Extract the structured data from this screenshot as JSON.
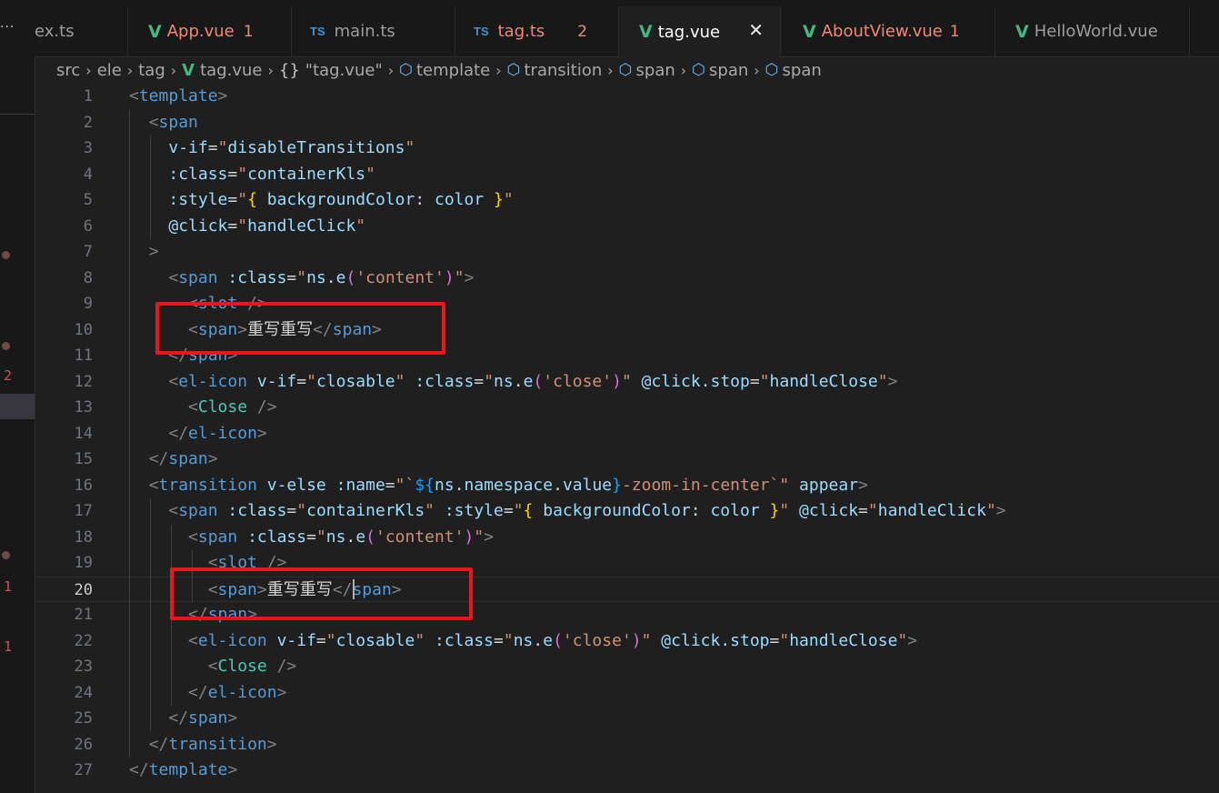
{
  "tabs": [
    {
      "label": "ex.ts",
      "kind": "none",
      "badge": "",
      "error": false,
      "active": false
    },
    {
      "label": "App.vue",
      "kind": "vue",
      "badge": "1",
      "error": true,
      "active": false
    },
    {
      "label": "main.ts",
      "kind": "ts",
      "badge": "",
      "error": false,
      "active": false
    },
    {
      "label": "tag.ts",
      "kind": "ts",
      "badge": "2",
      "error": true,
      "active": false
    },
    {
      "label": "tag.vue",
      "kind": "vue",
      "badge": "",
      "error": false,
      "active": true
    },
    {
      "label": "AboutView.vue",
      "kind": "vue",
      "badge": "1",
      "error": true,
      "active": false
    },
    {
      "label": "HelloWorld.vue",
      "kind": "vue",
      "badge": "",
      "error": false,
      "active": false
    }
  ],
  "icons": {
    "vue": "V",
    "ts": "TS",
    "close": "✕",
    "more": "···",
    "cube": "⬡",
    "braces": "{}",
    "chevron": "›"
  },
  "breadcrumb": [
    "src",
    "ele",
    "tag",
    "tag.vue",
    "\"tag.vue\"",
    "template",
    "transition",
    "span",
    "span",
    "span"
  ],
  "gutter_markers": [
    "2",
    "1",
    "1"
  ],
  "current_line": 20,
  "lines": [
    {
      "n": "1",
      "tokens": [
        [
          "p",
          "<"
        ],
        [
          "tg",
          "template"
        ],
        [
          "p",
          ">"
        ]
      ]
    },
    {
      "n": "2",
      "tokens": [
        [
          "wh",
          "  "
        ],
        [
          "p",
          "<"
        ],
        [
          "tg",
          "span"
        ]
      ]
    },
    {
      "n": "3",
      "tokens": [
        [
          "wh",
          "    "
        ],
        [
          "at",
          "v-if"
        ],
        [
          "wh",
          "="
        ],
        [
          "st",
          "\""
        ],
        [
          "at",
          "disableTransitions"
        ],
        [
          "st",
          "\""
        ]
      ]
    },
    {
      "n": "4",
      "tokens": [
        [
          "wh",
          "    "
        ],
        [
          "at",
          ":class"
        ],
        [
          "wh",
          "="
        ],
        [
          "st",
          "\""
        ],
        [
          "at",
          "containerKls"
        ],
        [
          "st",
          "\""
        ]
      ]
    },
    {
      "n": "5",
      "tokens": [
        [
          "wh",
          "    "
        ],
        [
          "at",
          ":style"
        ],
        [
          "wh",
          "="
        ],
        [
          "st",
          "\""
        ],
        [
          "bk",
          "{"
        ],
        [
          "at",
          " backgroundColor"
        ],
        [
          "wh",
          ": "
        ],
        [
          "at",
          "color"
        ],
        [
          "bk",
          " }"
        ],
        [
          "st",
          "\""
        ]
      ]
    },
    {
      "n": "6",
      "tokens": [
        [
          "wh",
          "    "
        ],
        [
          "at",
          "@click"
        ],
        [
          "wh",
          "="
        ],
        [
          "st",
          "\""
        ],
        [
          "at",
          "handleClick"
        ],
        [
          "st",
          "\""
        ]
      ]
    },
    {
      "n": "7",
      "tokens": [
        [
          "wh",
          "  "
        ],
        [
          "p",
          ">"
        ]
      ]
    },
    {
      "n": "8",
      "tokens": [
        [
          "wh",
          "    "
        ],
        [
          "p",
          "<"
        ],
        [
          "tg",
          "span"
        ],
        [
          "at",
          " :class"
        ],
        [
          "wh",
          "="
        ],
        [
          "st",
          "\""
        ],
        [
          "at",
          "ns"
        ],
        [
          "wh",
          "."
        ],
        [
          "at",
          "e"
        ],
        [
          "pk",
          "("
        ],
        [
          "st",
          "'content'"
        ],
        [
          "pk",
          ")"
        ],
        [
          "st",
          "\""
        ],
        [
          "p",
          ">"
        ]
      ]
    },
    {
      "n": "9",
      "tokens": [
        [
          "wh",
          "      "
        ],
        [
          "p",
          "<"
        ],
        [
          "tg",
          "slot"
        ],
        [
          "p",
          " />"
        ]
      ]
    },
    {
      "n": "10",
      "tokens": [
        [
          "wh",
          "      "
        ],
        [
          "p",
          "<"
        ],
        [
          "tg",
          "span"
        ],
        [
          "p",
          ">"
        ],
        [
          "tx",
          "重写重写"
        ],
        [
          "p",
          "</"
        ],
        [
          "tg",
          "span"
        ],
        [
          "p",
          ">"
        ]
      ]
    },
    {
      "n": "11",
      "tokens": [
        [
          "wh",
          "    "
        ],
        [
          "p",
          "</"
        ],
        [
          "tg",
          "span"
        ],
        [
          "p",
          ">"
        ]
      ]
    },
    {
      "n": "12",
      "tokens": [
        [
          "wh",
          "    "
        ],
        [
          "p",
          "<"
        ],
        [
          "tg",
          "el-icon"
        ],
        [
          "at",
          " v-if"
        ],
        [
          "wh",
          "="
        ],
        [
          "st",
          "\""
        ],
        [
          "at",
          "closable"
        ],
        [
          "st",
          "\""
        ],
        [
          "at",
          " :class"
        ],
        [
          "wh",
          "="
        ],
        [
          "st",
          "\""
        ],
        [
          "at",
          "ns"
        ],
        [
          "wh",
          "."
        ],
        [
          "at",
          "e"
        ],
        [
          "pk",
          "("
        ],
        [
          "st",
          "'close'"
        ],
        [
          "pk",
          ")"
        ],
        [
          "st",
          "\""
        ],
        [
          "at",
          " @click.stop"
        ],
        [
          "wh",
          "="
        ],
        [
          "st",
          "\""
        ],
        [
          "at",
          "handleClose"
        ],
        [
          "st",
          "\""
        ],
        [
          "p",
          ">"
        ]
      ]
    },
    {
      "n": "13",
      "tokens": [
        [
          "wh",
          "      "
        ],
        [
          "p",
          "<"
        ],
        [
          "cm",
          "Close"
        ],
        [
          "p",
          " />"
        ]
      ]
    },
    {
      "n": "14",
      "tokens": [
        [
          "wh",
          "    "
        ],
        [
          "p",
          "</"
        ],
        [
          "tg",
          "el-icon"
        ],
        [
          "p",
          ">"
        ]
      ]
    },
    {
      "n": "15",
      "tokens": [
        [
          "wh",
          "  "
        ],
        [
          "p",
          "</"
        ],
        [
          "tg",
          "span"
        ],
        [
          "p",
          ">"
        ]
      ]
    },
    {
      "n": "16",
      "tokens": [
        [
          "wh",
          "  "
        ],
        [
          "p",
          "<"
        ],
        [
          "tg",
          "transition"
        ],
        [
          "at",
          " v-else"
        ],
        [
          "at",
          " :name"
        ],
        [
          "wh",
          "="
        ],
        [
          "st",
          "\""
        ],
        [
          "st",
          "`"
        ],
        [
          "bl",
          "${"
        ],
        [
          "at",
          "ns"
        ],
        [
          "wh",
          "."
        ],
        [
          "at",
          "namespace"
        ],
        [
          "wh",
          "."
        ],
        [
          "at",
          "value"
        ],
        [
          "bl",
          "}"
        ],
        [
          "st",
          "-zoom-in-center`"
        ],
        [
          "st",
          "\""
        ],
        [
          "at",
          " appear"
        ],
        [
          "p",
          ">"
        ]
      ]
    },
    {
      "n": "17",
      "tokens": [
        [
          "wh",
          "    "
        ],
        [
          "p",
          "<"
        ],
        [
          "tg",
          "span"
        ],
        [
          "at",
          " :class"
        ],
        [
          "wh",
          "="
        ],
        [
          "st",
          "\""
        ],
        [
          "at",
          "containerKls"
        ],
        [
          "st",
          "\""
        ],
        [
          "at",
          " :style"
        ],
        [
          "wh",
          "="
        ],
        [
          "st",
          "\""
        ],
        [
          "bk",
          "{"
        ],
        [
          "at",
          " backgroundColor"
        ],
        [
          "wh",
          ": "
        ],
        [
          "at",
          "color"
        ],
        [
          "bk",
          " }"
        ],
        [
          "st",
          "\""
        ],
        [
          "at",
          " @click"
        ],
        [
          "wh",
          "="
        ],
        [
          "st",
          "\""
        ],
        [
          "at",
          "handleClick"
        ],
        [
          "st",
          "\""
        ],
        [
          "p",
          ">"
        ]
      ]
    },
    {
      "n": "18",
      "tokens": [
        [
          "wh",
          "      "
        ],
        [
          "p",
          "<"
        ],
        [
          "tg",
          "span"
        ],
        [
          "at",
          " :class"
        ],
        [
          "wh",
          "="
        ],
        [
          "st",
          "\""
        ],
        [
          "at",
          "ns"
        ],
        [
          "wh",
          "."
        ],
        [
          "at",
          "e"
        ],
        [
          "pk",
          "("
        ],
        [
          "st",
          "'content'"
        ],
        [
          "pk",
          ")"
        ],
        [
          "st",
          "\""
        ],
        [
          "p",
          ">"
        ]
      ]
    },
    {
      "n": "19",
      "tokens": [
        [
          "wh",
          "        "
        ],
        [
          "p",
          "<"
        ],
        [
          "tg",
          "slot"
        ],
        [
          "p",
          " />"
        ]
      ]
    },
    {
      "n": "20",
      "tokens": [
        [
          "wh",
          "        "
        ],
        [
          "p",
          "<"
        ],
        [
          "tg",
          "span"
        ],
        [
          "p",
          ">"
        ],
        [
          "tx",
          "重写重写"
        ],
        [
          "p",
          "</"
        ],
        [
          "tg",
          "span"
        ],
        [
          "p",
          ">"
        ]
      ]
    },
    {
      "n": "21",
      "tokens": [
        [
          "wh",
          "      "
        ],
        [
          "p",
          "</"
        ],
        [
          "tg",
          "span"
        ],
        [
          "p",
          ">"
        ]
      ]
    },
    {
      "n": "22",
      "tokens": [
        [
          "wh",
          "      "
        ],
        [
          "p",
          "<"
        ],
        [
          "tg",
          "el-icon"
        ],
        [
          "at",
          " v-if"
        ],
        [
          "wh",
          "="
        ],
        [
          "st",
          "\""
        ],
        [
          "at",
          "closable"
        ],
        [
          "st",
          "\""
        ],
        [
          "at",
          " :class"
        ],
        [
          "wh",
          "="
        ],
        [
          "st",
          "\""
        ],
        [
          "at",
          "ns"
        ],
        [
          "wh",
          "."
        ],
        [
          "at",
          "e"
        ],
        [
          "pk",
          "("
        ],
        [
          "st",
          "'close'"
        ],
        [
          "pk",
          ")"
        ],
        [
          "st",
          "\""
        ],
        [
          "at",
          " @click.stop"
        ],
        [
          "wh",
          "="
        ],
        [
          "st",
          "\""
        ],
        [
          "at",
          "handleClose"
        ],
        [
          "st",
          "\""
        ],
        [
          "p",
          ">"
        ]
      ]
    },
    {
      "n": "23",
      "tokens": [
        [
          "wh",
          "        "
        ],
        [
          "p",
          "<"
        ],
        [
          "cm",
          "Close"
        ],
        [
          "p",
          " />"
        ]
      ]
    },
    {
      "n": "24",
      "tokens": [
        [
          "wh",
          "      "
        ],
        [
          "p",
          "</"
        ],
        [
          "tg",
          "el-icon"
        ],
        [
          "p",
          ">"
        ]
      ]
    },
    {
      "n": "25",
      "tokens": [
        [
          "wh",
          "    "
        ],
        [
          "p",
          "</"
        ],
        [
          "tg",
          "span"
        ],
        [
          "p",
          ">"
        ]
      ]
    },
    {
      "n": "26",
      "tokens": [
        [
          "wh",
          "  "
        ],
        [
          "p",
          "</"
        ],
        [
          "tg",
          "transition"
        ],
        [
          "p",
          ">"
        ]
      ]
    },
    {
      "n": "27",
      "tokens": [
        [
          "p",
          "</"
        ],
        [
          "tg",
          "template"
        ],
        [
          "p",
          ">"
        ]
      ]
    }
  ],
  "colors": {
    "accent_vue": "#41b883",
    "accent_ts": "#3f93d1",
    "error": "#f48771",
    "highlight_box": "#e8161d"
  }
}
